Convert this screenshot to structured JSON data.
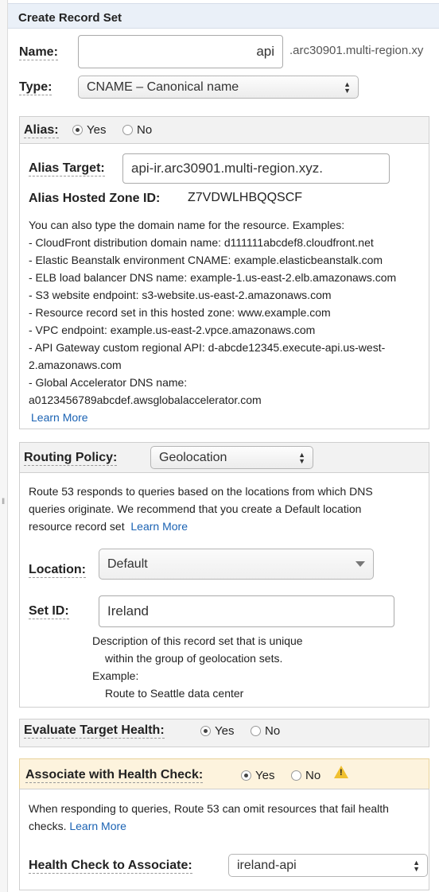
{
  "panel": {
    "title": "Create Record Set"
  },
  "name": {
    "label": "Name:",
    "value": "api",
    "suffix": ".arc30901.multi-region.xy"
  },
  "type": {
    "label": "Type:",
    "selected": "CNAME – Canonical name"
  },
  "alias": {
    "label": "Alias:",
    "yes_label": "Yes",
    "no_label": "No",
    "selected": "Yes",
    "target_label": "Alias Target:",
    "target_value": "api-ir.arc30901.multi-region.xyz.",
    "hosted_zone_label": "Alias Hosted Zone ID:",
    "hosted_zone_value": "Z7VDWLHBQQSCF",
    "help_intro": "You can also type the domain name for the resource. Examples:",
    "examples": [
      "-  CloudFront distribution domain name: d111111abcdef8.cloudfront.net",
      "-  Elastic Beanstalk environment CNAME: example.elasticbeanstalk.com",
      "-  ELB load balancer DNS name: example-1.us-east-2.elb.amazonaws.com",
      "-  S3 website endpoint: s3-website.us-east-2.amazonaws.com",
      "-  Resource record set in this hosted zone: www.example.com",
      "-  VPC endpoint: example.us-east-2.vpce.amazonaws.com",
      "-  API Gateway custom regional API: d-abcde12345.execute-api.us-west-",
      "2.amazonaws.com",
      "-  Global Accelerator DNS name:",
      "a0123456789abcdef.awsglobalaccelerator.com"
    ],
    "learn_more": "Learn More"
  },
  "routing": {
    "label": "Routing Policy:",
    "selected": "Geolocation",
    "help_lines": [
      "Route 53 responds to queries based on the locations from which DNS",
      "queries originate. We recommend that you create a Default location",
      "resource record set"
    ],
    "learn_more": "Learn More",
    "location_label": "Location:",
    "location_value": "Default",
    "setid_label": "Set ID:",
    "setid_value": "Ireland",
    "setid_help": [
      "Description of this record set that is unique",
      "within the group of geolocation sets.",
      "Example:",
      "Route to Seattle data center"
    ]
  },
  "eval_health": {
    "label": "Evaluate Target Health:",
    "yes_label": "Yes",
    "no_label": "No",
    "selected": "Yes"
  },
  "health_check": {
    "label": "Associate with Health Check:",
    "yes_label": "Yes",
    "no_label": "No",
    "selected": "Yes",
    "help_lines": [
      "When responding to queries, Route 53 can omit resources that fail health",
      "checks."
    ],
    "learn_more": "Learn More",
    "assoc_label": "Health Check to Associate:",
    "assoc_value": "ireland-api"
  },
  "colors": {
    "header_bg": "#eaf0f8",
    "link": "#1a62b3",
    "warning_bg": "#fdf3dd",
    "warning_icon": "#f0c030"
  }
}
